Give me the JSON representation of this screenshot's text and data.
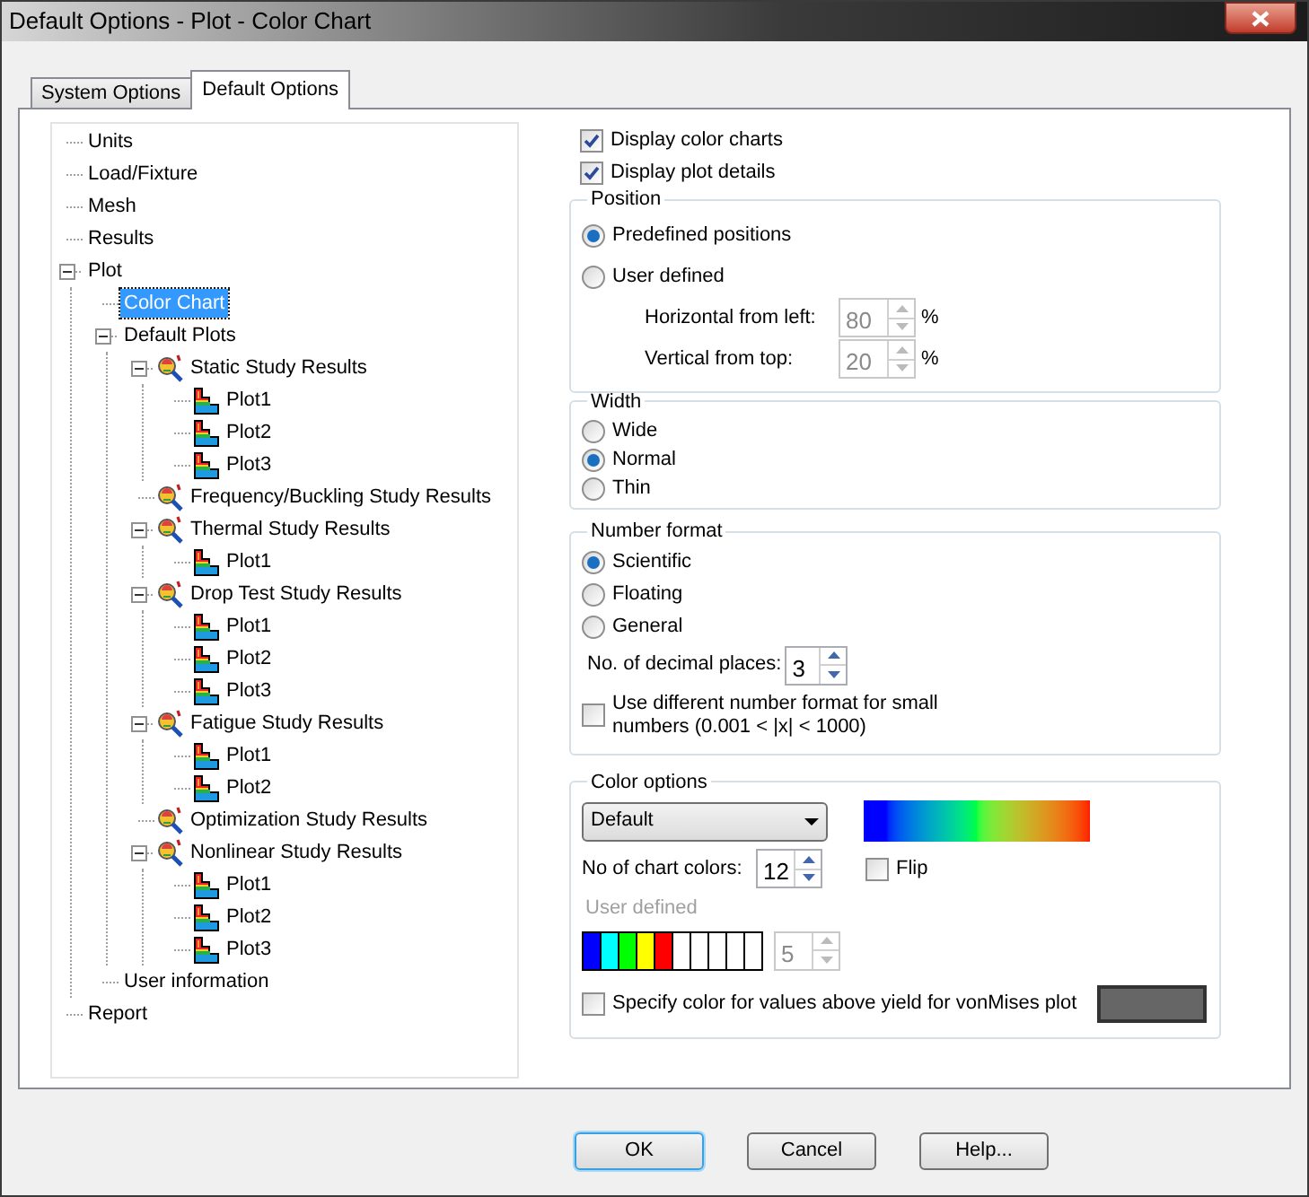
{
  "window": {
    "title": "Default Options - Plot - Color Chart"
  },
  "tabs": [
    {
      "label": "System Options",
      "selected": false
    },
    {
      "label": "Default Options",
      "selected": true
    }
  ],
  "tree": [
    {
      "label": "Units",
      "selected": false
    },
    {
      "label": "Load/Fixture",
      "selected": false
    },
    {
      "label": "Mesh",
      "selected": false
    },
    {
      "label": "Results",
      "selected": false
    },
    {
      "label": "Plot",
      "selected": false,
      "expanded": true,
      "children": [
        {
          "label": "Color Chart",
          "selected": true
        },
        {
          "label": "Default Plots",
          "selected": false,
          "expanded": true,
          "children": [
            {
              "label": "Static Study Results",
              "kind": "study",
              "selected": false,
              "expanded": true,
              "children": [
                {
                  "label": "Plot1",
                  "kind": "plot",
                  "selected": false
                },
                {
                  "label": "Plot2",
                  "kind": "plot",
                  "selected": false
                },
                {
                  "label": "Plot3",
                  "kind": "plot",
                  "selected": false
                }
              ]
            },
            {
              "label": "Frequency/Buckling Study Results",
              "kind": "study",
              "selected": false
            },
            {
              "label": "Thermal Study Results",
              "kind": "study",
              "selected": false,
              "expanded": true,
              "children": [
                {
                  "label": "Plot1",
                  "kind": "plot",
                  "selected": false
                }
              ]
            },
            {
              "label": "Drop Test Study Results",
              "kind": "study",
              "selected": false,
              "expanded": true,
              "children": [
                {
                  "label": "Plot1",
                  "kind": "plot",
                  "selected": false
                },
                {
                  "label": "Plot2",
                  "kind": "plot",
                  "selected": false
                },
                {
                  "label": "Plot3",
                  "kind": "plot",
                  "selected": false
                }
              ]
            },
            {
              "label": "Fatigue Study Results",
              "kind": "study",
              "selected": false,
              "expanded": true,
              "children": [
                {
                  "label": "Plot1",
                  "kind": "plot",
                  "selected": false
                },
                {
                  "label": "Plot2",
                  "kind": "plot",
                  "selected": false
                }
              ]
            },
            {
              "label": "Optimization Study Results",
              "kind": "study",
              "selected": false
            },
            {
              "label": "Nonlinear Study Results",
              "kind": "study",
              "selected": false,
              "expanded": true,
              "children": [
                {
                  "label": "Plot1",
                  "kind": "plot",
                  "selected": false
                },
                {
                  "label": "Plot2",
                  "kind": "plot",
                  "selected": false
                },
                {
                  "label": "Plot3",
                  "kind": "plot",
                  "selected": false
                }
              ]
            }
          ]
        },
        {
          "label": "User information",
          "selected": false
        }
      ]
    },
    {
      "label": "Report",
      "selected": false
    }
  ],
  "display_options": [
    {
      "label": "Display color charts",
      "checked": true
    },
    {
      "label": "Display plot details",
      "checked": true
    }
  ],
  "position": {
    "title": "Position",
    "options": [
      {
        "label": "Predefined positions",
        "selected": true
      },
      {
        "label": "User defined",
        "selected": false
      }
    ],
    "fields": [
      {
        "label": "Horizontal from left:",
        "value": "80",
        "unit": "%",
        "disabled": true
      },
      {
        "label": "Vertical from top:",
        "value": "20",
        "unit": "%",
        "disabled": true
      }
    ]
  },
  "width": {
    "title": "Width",
    "options": [
      {
        "label": "Wide",
        "selected": false
      },
      {
        "label": "Normal",
        "selected": true
      },
      {
        "label": "Thin",
        "selected": false
      }
    ]
  },
  "number_format": {
    "title": "Number format",
    "options": [
      {
        "label": "Scientific",
        "selected": true
      },
      {
        "label": "Floating",
        "selected": false
      },
      {
        "label": "General",
        "selected": false
      }
    ],
    "decimal_places": {
      "label": "No. of decimal places:",
      "value": "3",
      "disabled": false
    },
    "small_numbers": {
      "label": "Use different number format for small numbers (0.001 < |x| < 1000)",
      "checked": false
    }
  },
  "color_options": {
    "title": "Color options",
    "scheme": "Default",
    "chart_colors": {
      "label": "No of chart colors:",
      "value": "12",
      "disabled": false
    },
    "flip": {
      "label": "Flip",
      "checked": false
    },
    "user_defined": {
      "label": "User defined",
      "disabled": true,
      "count": {
        "value": "5",
        "disabled": true
      },
      "swatches": [
        {
          "color": "#0000ff"
        },
        {
          "color": "#00ffff"
        },
        {
          "color": "#00ff00"
        },
        {
          "color": "#ffff00"
        },
        {
          "color": "#ff0000"
        },
        {
          "color": "#ffffff"
        },
        {
          "color": "#ffffff"
        },
        {
          "color": "#ffffff"
        },
        {
          "color": "#ffffff"
        },
        {
          "color": "#ffffff"
        }
      ]
    },
    "yield": {
      "label": "Specify color for values above yield for vonMises plot",
      "checked": false,
      "color": "#666666"
    }
  },
  "buttons": [
    {
      "label": "OK",
      "default": true
    },
    {
      "label": "Cancel",
      "default": false
    },
    {
      "label": "Help...",
      "default": false
    }
  ]
}
